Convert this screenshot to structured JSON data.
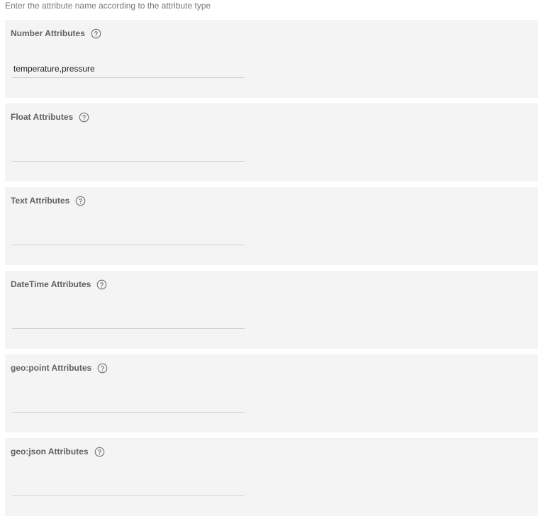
{
  "hint_text": "Enter the attribute name according to the attribute type",
  "help_icon": "question-circle-icon",
  "sections": [
    {
      "title": "Number Attributes",
      "value": "temperature,pressure",
      "placeholder": ""
    },
    {
      "title": "Float Attributes",
      "value": "",
      "placeholder": ""
    },
    {
      "title": "Text Attributes",
      "value": "",
      "placeholder": ""
    },
    {
      "title": "DateTime Attributes",
      "value": "",
      "placeholder": ""
    },
    {
      "title": "geo:point Attributes",
      "value": "",
      "placeholder": ""
    },
    {
      "title": "geo:json Attributes",
      "value": "",
      "placeholder": ""
    }
  ]
}
